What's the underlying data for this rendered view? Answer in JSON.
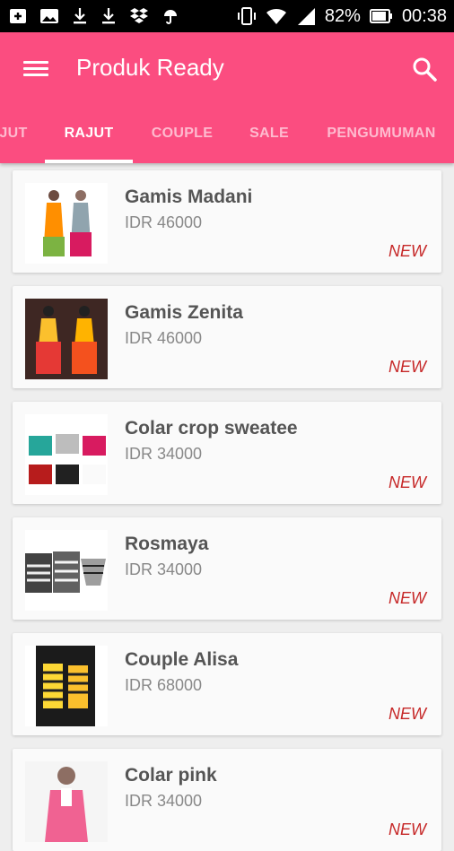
{
  "status_bar": {
    "battery_percent": "82%",
    "time": "00:38",
    "icons_left": [
      "cast-icon",
      "image-icon",
      "download-icon",
      "download-icon",
      "dropbox-icon",
      "weather-icon"
    ],
    "icons_right": [
      "vibrate-icon",
      "wifi-icon",
      "signal-icon",
      "battery-icon"
    ]
  },
  "toolbar": {
    "title": "Produk Ready",
    "menu_icon": "hamburger-menu-icon",
    "search_icon": "search-icon",
    "color": "#fb4d80"
  },
  "tabs": [
    {
      "label": "JUT",
      "active": false
    },
    {
      "label": "RAJUT",
      "active": true
    },
    {
      "label": "COUPLE",
      "active": false
    },
    {
      "label": "SALE",
      "active": false
    },
    {
      "label": "PENGUMUMAN",
      "active": false
    }
  ],
  "products": [
    {
      "name": "Gamis Madani",
      "price": "IDR 46000",
      "badge": "NEW"
    },
    {
      "name": "Gamis Zenita",
      "price": "IDR 46000",
      "badge": "NEW"
    },
    {
      "name": "Colar crop sweatee",
      "price": "IDR 34000",
      "badge": "NEW"
    },
    {
      "name": "Rosmaya",
      "price": "IDR 34000",
      "badge": "NEW"
    },
    {
      "name": "Couple Alisa",
      "price": "IDR 68000",
      "badge": "NEW"
    },
    {
      "name": "Colar pink",
      "price": "IDR 34000",
      "badge": "NEW"
    }
  ],
  "colors": {
    "accent": "#fb4d80",
    "badge": "#c62828"
  }
}
